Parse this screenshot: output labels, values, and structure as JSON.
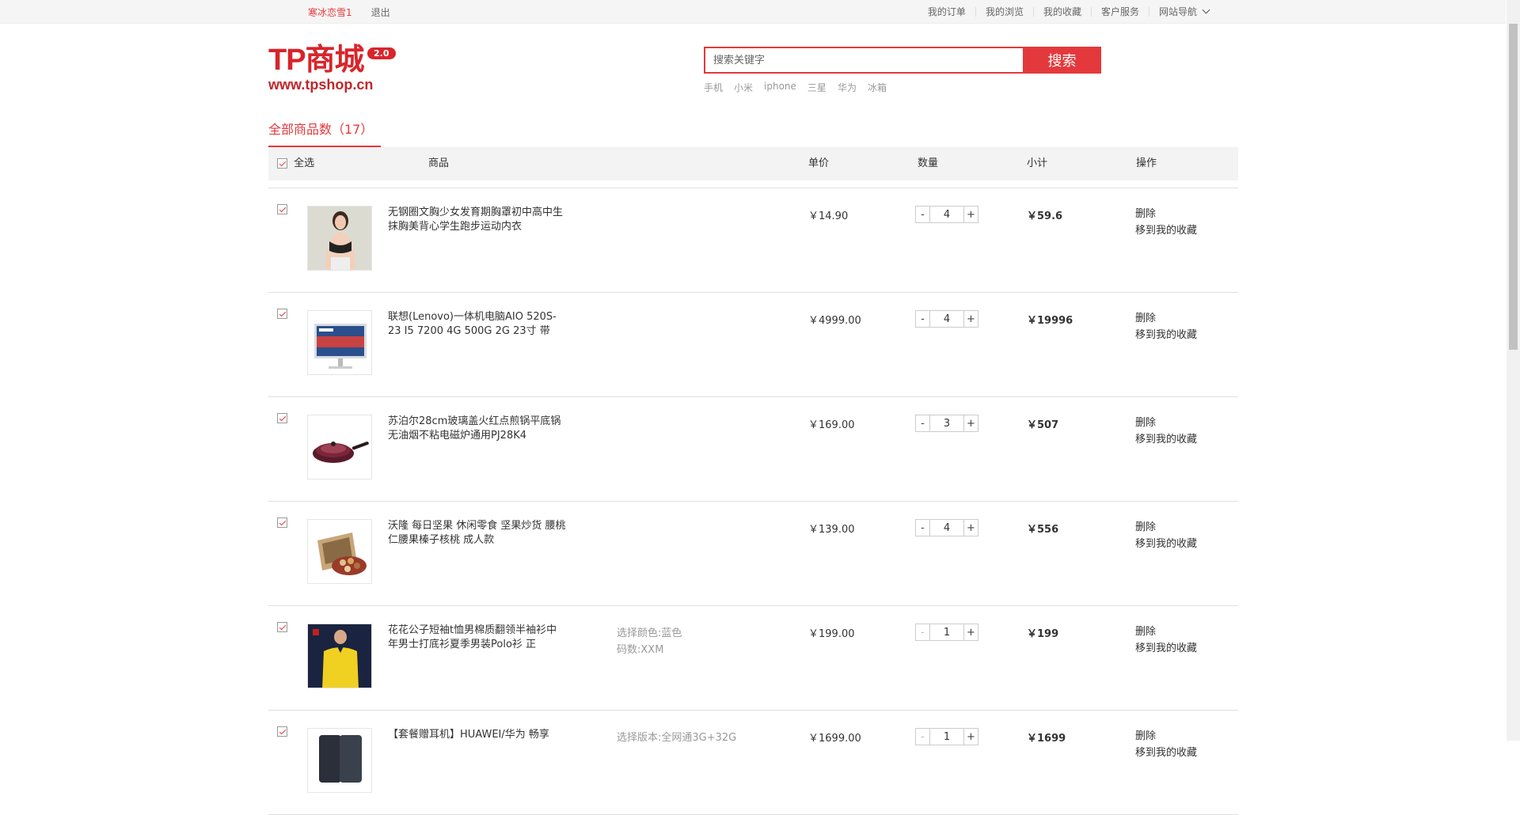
{
  "topbar": {
    "username": "寒冰恋雪1",
    "logout": "退出",
    "links": [
      "我的订单",
      "我的浏览",
      "我的收藏",
      "客户服务",
      "网站导航"
    ]
  },
  "header": {
    "logo_text": "TP商城",
    "logo_version": "2.0",
    "logo_url": "www.tpshop.cn",
    "search_placeholder": "搜索关键字",
    "search_button": "搜索",
    "hot_keywords": [
      "手机",
      "小米",
      "iphone",
      "三星",
      "华为",
      "冰箱"
    ]
  },
  "cart": {
    "tab_label": "全部商品数（17）",
    "columns": {
      "select_all": "全选",
      "product": "商品",
      "unit_price": "单价",
      "quantity": "数量",
      "subtotal": "小计",
      "actions": "操作"
    },
    "action_delete": "删除",
    "action_favorite": "移到我的收藏",
    "items": [
      {
        "title": "无钢圈文胸少女发育期胸罩初中高中生抹胸美背心学生跑步运动内衣",
        "spec1": "",
        "spec2": "",
        "price": "￥14.90",
        "qty": "4",
        "subtotal": "￥59.6"
      },
      {
        "title": "联想(Lenovo)一体机电脑AIO 520S-23 I5 7200 4G 500G 2G 23寸 带",
        "spec1": "",
        "spec2": "",
        "price": "￥4999.00",
        "qty": "4",
        "subtotal": "￥19996"
      },
      {
        "title": "苏泊尔28cm玻璃盖火红点煎锅平底锅无油烟不粘电磁炉通用PJ28K4",
        "spec1": "",
        "spec2": "",
        "price": "￥169.00",
        "qty": "3",
        "subtotal": "￥507"
      },
      {
        "title": "沃隆 每日坚果 休闲零食 坚果炒货 腰桃仁腰果榛子核桃 成人款",
        "spec1": "",
        "spec2": "",
        "price": "￥139.00",
        "qty": "4",
        "subtotal": "￥556"
      },
      {
        "title": "花花公子短袖t恤男棉质翻领半袖衫中年男士打底衫夏季男装Polo衫 正",
        "spec1": "选择颜色:蓝色",
        "spec2": "码数:XXM",
        "price": "￥199.00",
        "qty": "1",
        "subtotal": "￥199"
      },
      {
        "title": "【套餐赠耳机】HUAWEI/华为 畅享",
        "spec1": "选择版本:全网通3G+32G",
        "spec2": "",
        "price": "￥1699.00",
        "qty": "1",
        "subtotal": "￥1699"
      }
    ]
  },
  "colors": {
    "accent": "#e4393c",
    "logo": "#d9242b"
  }
}
